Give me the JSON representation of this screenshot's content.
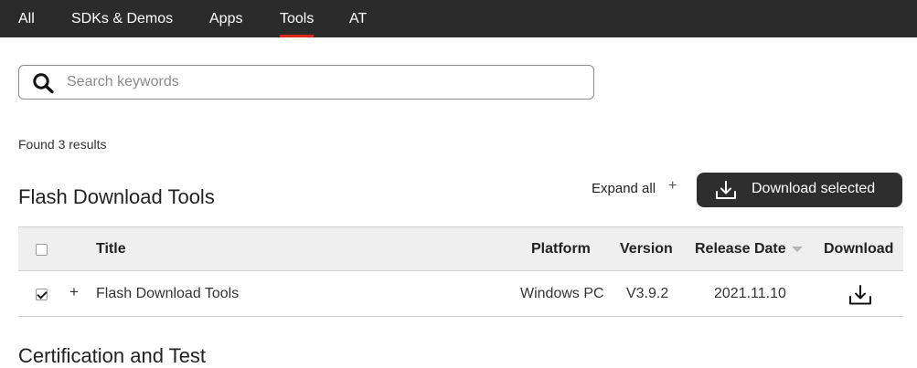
{
  "nav": {
    "tabs": [
      {
        "label": "All"
      },
      {
        "label": "SDKs & Demos"
      },
      {
        "label": "Apps"
      },
      {
        "label": "Tools",
        "active": true
      },
      {
        "label": "AT"
      }
    ],
    "active_color": "#e1251b"
  },
  "search": {
    "placeholder": "Search keywords",
    "value": "",
    "icon": "search-icon"
  },
  "results": {
    "count_text": "Found 3 results"
  },
  "section": {
    "title": "Flash Download Tools",
    "expand_all_label": "Expand all",
    "expand_icon": "+",
    "download_selected_label": "Download selected",
    "download_icon": "download-icon"
  },
  "table": {
    "headers": {
      "title": "Title",
      "platform": "Platform",
      "version": "Version",
      "release_date": "Release Date",
      "download": "Download"
    },
    "sort": {
      "column": "release_date",
      "direction": "desc"
    },
    "rows": [
      {
        "checked": true,
        "expand_icon": "+",
        "title": "Flash Download Tools",
        "platform": "Windows PC",
        "version": "V3.9.2",
        "release_date": "2021.11.10",
        "download_icon": "download-icon"
      }
    ]
  },
  "next_section": {
    "title": "Certification and Test"
  }
}
